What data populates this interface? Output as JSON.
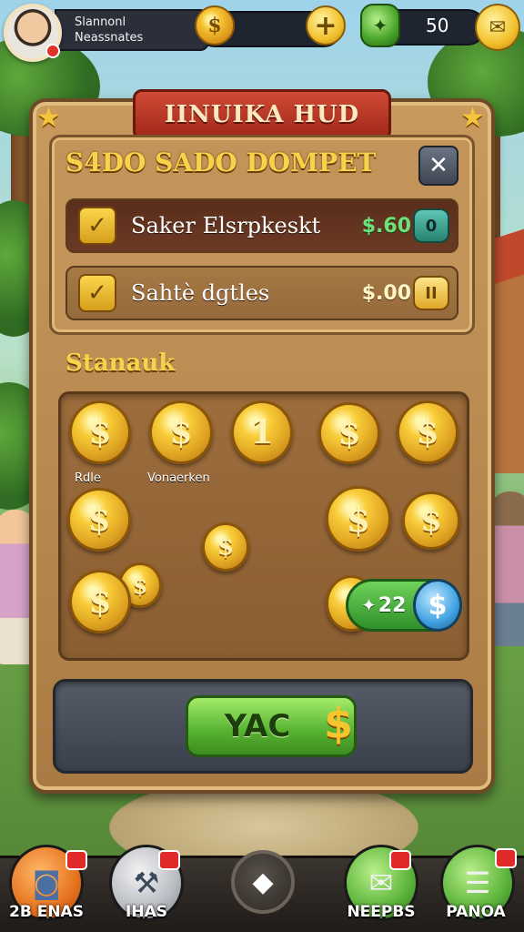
{
  "top_bar": {
    "name_line1": "Slannonl",
    "name_line2": "Neassnates",
    "gem_count": "50",
    "plus_symbol": "+"
  },
  "panel": {
    "ribbon_title": "IINUIKA HUD",
    "title": "S4DO SADO DOMPET",
    "close_symbol": "✕",
    "rows": [
      {
        "label": "Saker Elsrpkeskt",
        "amount": "$.60",
        "badge": "0"
      },
      {
        "label": "Sahtè dgtles",
        "amount": "$.00",
        "badge": "II"
      }
    ],
    "section_title": "Stanauk",
    "coin_symbol": "$",
    "coin_special": "1",
    "coin_labels": [
      "Rdle",
      "Vonaerken"
    ],
    "stat_pill_value": "22",
    "stat_pill_coin": "$",
    "action_button": "YAC",
    "action_sign": "$"
  },
  "bottom_nav": {
    "items": [
      {
        "label": "2B ENAS"
      },
      {
        "label": "IHAS"
      },
      {
        "label": ""
      },
      {
        "label": "NEEPBS"
      },
      {
        "label": "PANOA"
      }
    ]
  },
  "colors": {
    "accent_gold": "#f6d34a",
    "ribbon_red": "#d04a35",
    "action_green": "#55b130",
    "panel_wood": "#c89a5e"
  }
}
